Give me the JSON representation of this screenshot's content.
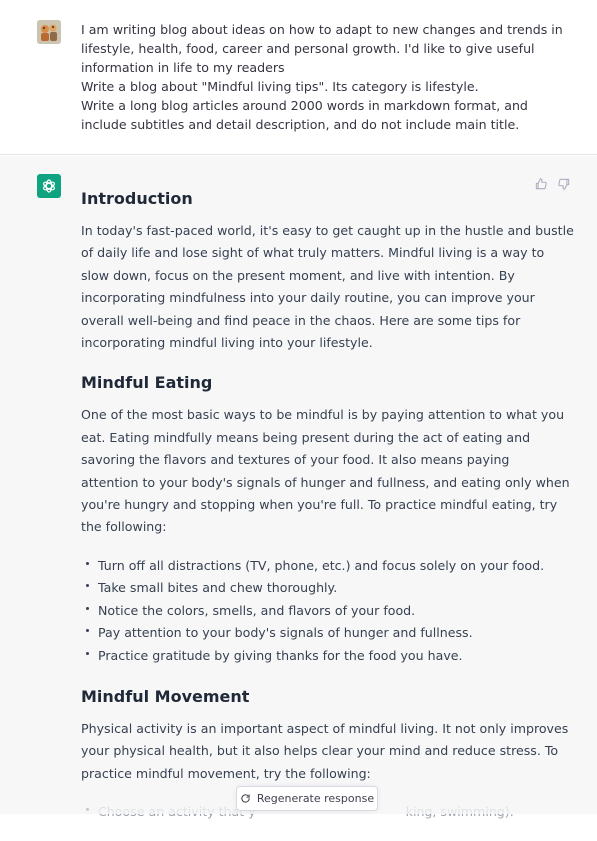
{
  "colors": {
    "assistant_bg": "#f7f7f8",
    "bot_avatar": "#10a37f",
    "text": "#374151"
  },
  "user_message": {
    "lines": [
      "I am writing blog about ideas on how to adapt to new changes and trends in",
      "lifestyle, health, food, career and personal growth. I'd like to give useful",
      "information in life to my readers",
      "Write a blog about \"Mindful living tips\". Its category is lifestyle.",
      "Write a long blog articles around 2000 words in markdown format, and",
      "include subtitles and detail description, and do not include main title."
    ]
  },
  "assistant_message": {
    "sections": [
      {
        "heading": "Introduction",
        "paragraph": [
          "In today's fast-paced world, it's easy to get caught up in the hustle and bustle",
          "of daily life and lose sight of what truly matters. Mindful living is a way to",
          "slow down, focus on the present moment, and live with intention. By",
          "incorporating mindfulness into your daily routine, you can improve your",
          "overall well-being and find peace in the chaos. Here are some tips for",
          "incorporating mindful living into your lifestyle."
        ]
      },
      {
        "heading": "Mindful Eating",
        "paragraph": [
          "One of the most basic ways to be mindful is by paying attention to what you",
          "eat. Eating mindfully means being present during the act of eating and",
          "savoring the flavors and textures of your food. It also means paying",
          "attention to your body's signals of hunger and fullness, and eating only when",
          "you're hungry and stopping when you're full. To practice mindful eating, try",
          "the following:"
        ],
        "bullets": [
          "Turn off all distractions (TV, phone, etc.) and focus solely on your food.",
          "Take small bites and chew thoroughly.",
          "Notice the colors, smells, and flavors of your food.",
          "Pay attention to your body's signals of hunger and fullness.",
          "Practice gratitude by giving thanks for the food you have."
        ]
      },
      {
        "heading": "Mindful Movement",
        "paragraph": [
          "Physical activity is an important aspect of mindful living. It not only improves",
          "your physical health, but it also helps clear your mind and reduce stress. To",
          "practice mindful movement, try the following:"
        ],
        "partial_bullet_left": "Choose an activity that y",
        "partial_bullet_right": "king, swimming)."
      }
    ]
  },
  "controls": {
    "regenerate_label": "Regenerate response",
    "thumbs_up_icon": "thumbs-up-icon",
    "thumbs_down_icon": "thumbs-down-icon",
    "regenerate_icon": "refresh-icon"
  }
}
